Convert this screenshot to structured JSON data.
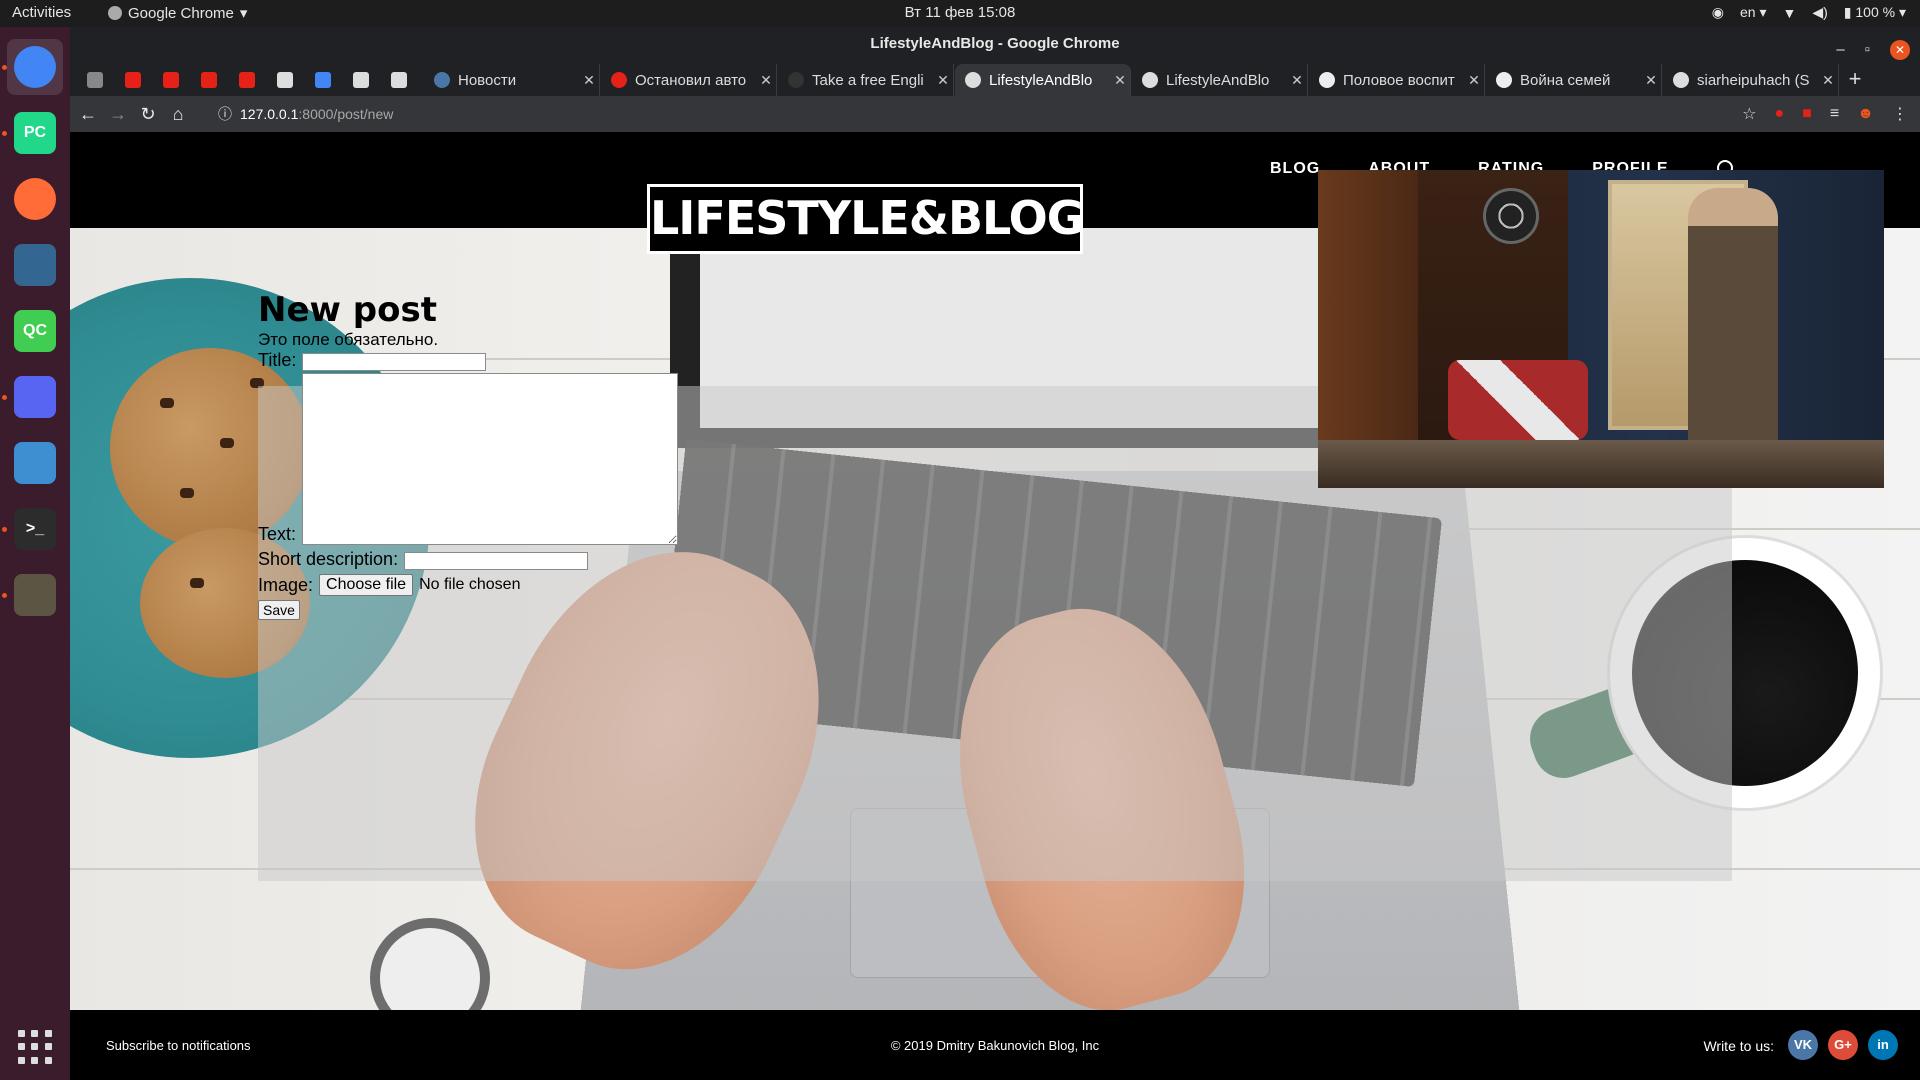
{
  "topbar": {
    "activities": "Activities",
    "app_name": "Google Chrome",
    "clock": "Вт 11 фев  15:08",
    "lang": "en",
    "battery": "100 %"
  },
  "dock": {
    "items": [
      {
        "name": "chrome",
        "color": "#4285f4",
        "label": ""
      },
      {
        "name": "pycharm",
        "color": "#21d789",
        "label": "PC"
      },
      {
        "name": "postman",
        "color": "#ff6c37",
        "label": ""
      },
      {
        "name": "pgadmin",
        "color": "#336791",
        "label": ""
      },
      {
        "name": "qtcreator",
        "color": "#41cd52",
        "label": "QC"
      },
      {
        "name": "discord",
        "color": "#5865f2",
        "label": ""
      },
      {
        "name": "files",
        "color": "#3d8fd1",
        "label": ""
      },
      {
        "name": "terminal",
        "color": "#2c2c2c",
        "label": ">_"
      },
      {
        "name": "gimp",
        "color": "#5c5543",
        "label": ""
      }
    ]
  },
  "window": {
    "title": "LifestyleAndBlog - Google Chrome"
  },
  "tabs": [
    {
      "title": "Новости",
      "fav_color": "#4a76a8"
    },
    {
      "title": "Остановил авто",
      "fav_color": "#e62117"
    },
    {
      "title": "Take a free Engli",
      "fav_color": "#333333"
    },
    {
      "title": "LifestyleAndBlo",
      "fav_color": "#dddddd"
    },
    {
      "title": "LifestyleAndBlo",
      "fav_color": "#dddddd"
    },
    {
      "title": "Половое воспит",
      "fav_color": "#eeeeee"
    },
    {
      "title": "Война семей",
      "fav_color": "#eeeeee"
    },
    {
      "title": "siarheipuhach (S",
      "fav_color": "#dddddd"
    }
  ],
  "pinned_tabs": [
    {
      "icon": "camera-icon",
      "color": "#888888"
    },
    {
      "icon": "youtube-icon",
      "color": "#e62117"
    },
    {
      "icon": "red-flag-icon",
      "color": "#e62117"
    },
    {
      "icon": "youtube-icon",
      "color": "#e62117"
    },
    {
      "icon": "youtube-icon",
      "color": "#e62117"
    },
    {
      "icon": "grid-icon",
      "color": "#dddddd"
    },
    {
      "icon": "google-icon",
      "color": "#4285f4"
    },
    {
      "icon": "calendar-icon",
      "color": "#dddddd"
    },
    {
      "icon": "globe-icon",
      "color": "#dddddd"
    }
  ],
  "address": {
    "host": "127.0.0.1",
    "path": ":8000/post/new"
  },
  "site": {
    "nav": [
      "BLOG",
      "ABOUT",
      "RATING",
      "PROFILE"
    ],
    "logo": "LIFESTYLE&BLOG"
  },
  "form": {
    "heading": "New post",
    "error": "Это поле обязательно.",
    "title_label": "Title:",
    "title_value": "",
    "text_label": "Text:",
    "text_value": "",
    "short_label": "Short description:",
    "short_value": "",
    "image_label": "Image:",
    "file_button": "Choose file",
    "file_status": "No file chosen",
    "save": "Save"
  },
  "footer": {
    "subscribe": "Subscribe to notifications",
    "copyright": "© 2019 Dmitry Bakunovich Blog, Inc",
    "write": "Write to us:",
    "social": [
      {
        "label": "VK",
        "color": "#4a76a8"
      },
      {
        "label": "G+",
        "color": "#dd4b39"
      },
      {
        "label": "in",
        "color": "#0077b5"
      }
    ]
  }
}
